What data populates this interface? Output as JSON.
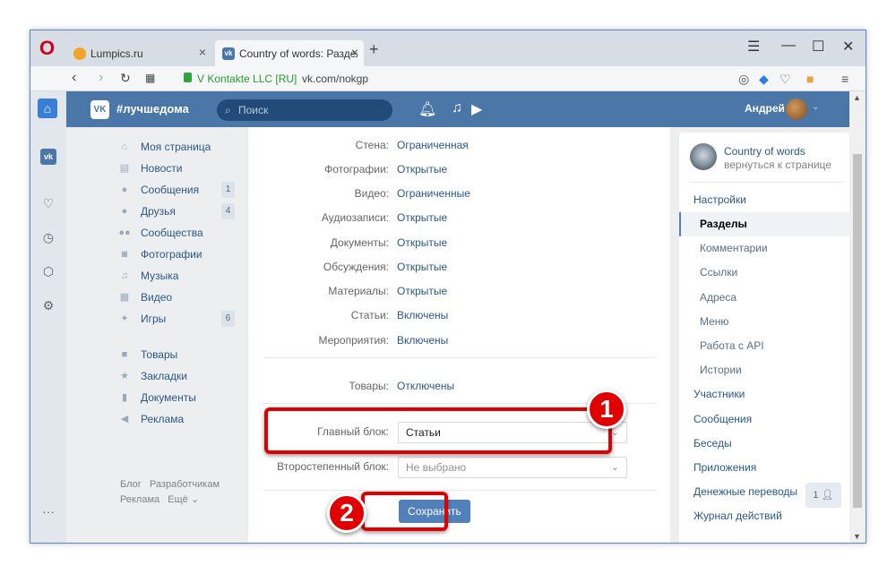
{
  "browser": {
    "tabs": [
      {
        "title": "Lumpics.ru",
        "close": "×"
      },
      {
        "title": "Country of words: Разделы",
        "close": "×"
      }
    ],
    "new_tab": "+",
    "site_identity": "V Kontakte LLC [RU]",
    "url": "vk.com/nokgp"
  },
  "vk": {
    "logo_text": "VK",
    "hashtag": "#лучшедома",
    "search_placeholder": "Поиск",
    "user_name": "Андрей"
  },
  "left_menu": {
    "items": [
      {
        "label": "Моя страница",
        "icon": "home-icon"
      },
      {
        "label": "Новости",
        "icon": "news-icon"
      },
      {
        "label": "Сообщения",
        "icon": "messages-icon",
        "count": "1"
      },
      {
        "label": "Друзья",
        "icon": "friends-icon",
        "count": "4"
      },
      {
        "label": "Сообщества",
        "icon": "groups-icon"
      },
      {
        "label": "Фотографии",
        "icon": "photo-icon"
      },
      {
        "label": "Музыка",
        "icon": "music-icon"
      },
      {
        "label": "Видео",
        "icon": "video-icon"
      },
      {
        "label": "Игры",
        "icon": "games-icon",
        "count": "6"
      },
      {
        "label": "Товары",
        "icon": "goods-icon"
      },
      {
        "label": "Закладки",
        "icon": "star-icon"
      },
      {
        "label": "Документы",
        "icon": "documents-icon"
      },
      {
        "label": "Реклама",
        "icon": "ads-icon"
      }
    ],
    "footer": {
      "blog": "Блог",
      "dev": "Разработчикам",
      "ads": "Реклама",
      "more": "Ещё ⌄"
    }
  },
  "sections": {
    "rows": [
      {
        "label": "Стена:",
        "value": "Ограниченная"
      },
      {
        "label": "Фотографии:",
        "value": "Открытые"
      },
      {
        "label": "Видео:",
        "value": "Ограниченные"
      },
      {
        "label": "Аудиозаписи:",
        "value": "Открытые"
      },
      {
        "label": "Документы:",
        "value": "Открытые"
      },
      {
        "label": "Обсуждения:",
        "value": "Открытые"
      },
      {
        "label": "Материалы:",
        "value": "Открытые"
      },
      {
        "label": "Статьи:",
        "value": "Включены"
      },
      {
        "label": "Мероприятия:",
        "value": "Включены"
      }
    ],
    "goods": {
      "label": "Товары:",
      "value": "Отключены"
    },
    "main_block": {
      "label": "Главный блок:",
      "value": "Статьи"
    },
    "secondary_block": {
      "label": "Второстепенный блок:",
      "value": "Не выбрано"
    },
    "save": "Сохранить"
  },
  "right_menu": {
    "group_name": "Country of words",
    "back_link": "вернуться к странице",
    "items": [
      {
        "label": "Настройки",
        "level": "top"
      },
      {
        "label": "Разделы",
        "level": "sub",
        "active": true
      },
      {
        "label": "Комментарии",
        "level": "sub"
      },
      {
        "label": "Ссылки",
        "level": "sub"
      },
      {
        "label": "Адреса",
        "level": "sub"
      },
      {
        "label": "Меню",
        "level": "sub"
      },
      {
        "label": "Работа с API",
        "level": "sub"
      },
      {
        "label": "Истории",
        "level": "sub"
      },
      {
        "label": "Участники",
        "level": "top"
      },
      {
        "label": "Сообщения",
        "level": "top"
      },
      {
        "label": "Беседы",
        "level": "top"
      },
      {
        "label": "Приложения",
        "level": "top"
      },
      {
        "label": "Денежные переводы",
        "level": "top"
      },
      {
        "label": "Журнал действий",
        "level": "top"
      }
    ],
    "chat_count": "1"
  },
  "annotations": {
    "first": "1",
    "second": "2",
    "color": "#e00000"
  },
  "colors": {
    "vk_blue": "#4a76a8",
    "link": "#2a5885",
    "button": "#5181b8"
  }
}
